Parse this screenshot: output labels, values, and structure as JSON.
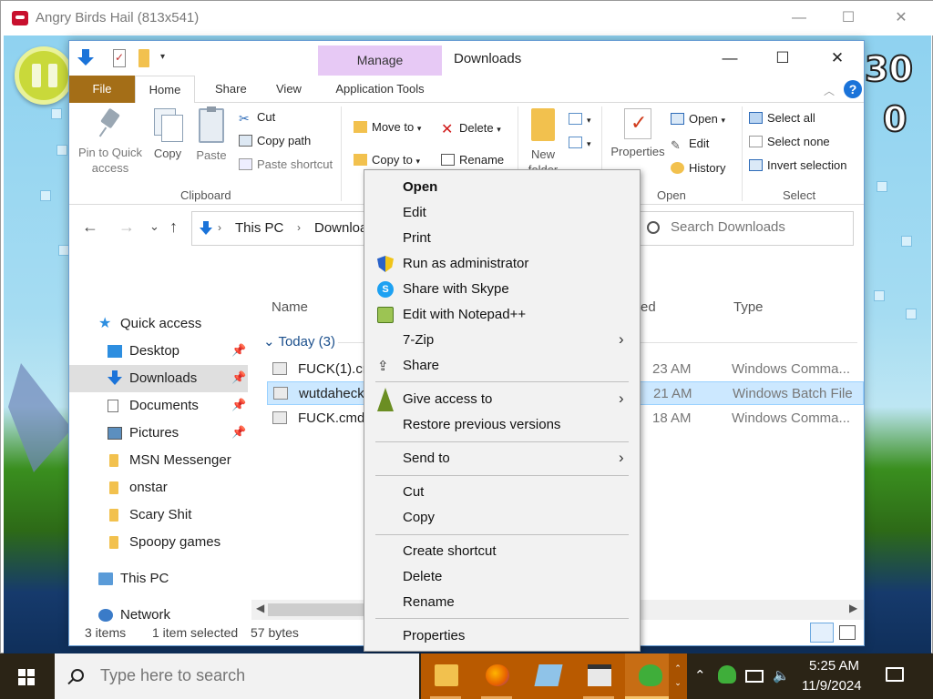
{
  "game_window": {
    "title": "Angry Birds Hail (813x541)",
    "controls": {
      "minimize": "—",
      "maximize": "☐",
      "close": "✕"
    },
    "scores": [
      "30",
      "0"
    ]
  },
  "explorer": {
    "title": "Downloads",
    "context_tab_header": "Manage",
    "controls": {
      "minimize": "—",
      "maximize": "☐",
      "close": "✕"
    },
    "tabs": {
      "file": "File",
      "home": "Home",
      "share": "Share",
      "view": "View",
      "app_tools": "Application Tools"
    },
    "ribbon": {
      "clipboard": {
        "group_label": "Clipboard",
        "pin": "Pin to Quick access",
        "copy": "Copy",
        "paste": "Paste",
        "cut": "Cut",
        "copy_path": "Copy path",
        "paste_shortcut": "Paste shortcut"
      },
      "organize": {
        "move_to": "Move to",
        "copy_to": "Copy to",
        "delete": "Delete",
        "rename": "Rename"
      },
      "new": {
        "new_folder": "New folder"
      },
      "open": {
        "group_label": "Open",
        "properties": "Properties",
        "open": "Open",
        "edit": "Edit",
        "history": "History"
      },
      "select": {
        "group_label": "Select",
        "select_all": "Select all",
        "select_none": "Select none",
        "invert": "Invert selection"
      }
    },
    "nav": {
      "back": "←",
      "forward": "→",
      "recent": "⌄",
      "up": "↑",
      "breadcrumb": [
        "This PC",
        "Downloads"
      ],
      "search_placeholder": "Search Downloads"
    },
    "sidebar": [
      {
        "label": "Quick access",
        "icon": "star-icon"
      },
      {
        "label": "Desktop",
        "icon": "desktop-icon",
        "pinned": true
      },
      {
        "label": "Downloads",
        "icon": "download-icon",
        "pinned": true,
        "selected": true
      },
      {
        "label": "Documents",
        "icon": "document-icon",
        "pinned": true
      },
      {
        "label": "Pictures",
        "icon": "pictures-icon",
        "pinned": true
      },
      {
        "label": "MSN Messenger",
        "icon": "folder-icon"
      },
      {
        "label": "onstar",
        "icon": "folder-icon"
      },
      {
        "label": "Scary Shit",
        "icon": "folder-icon"
      },
      {
        "label": "Spoopy games",
        "icon": "folder-icon"
      },
      {
        "label": "This PC",
        "icon": "computer-icon"
      },
      {
        "label": "Network",
        "icon": "network-icon"
      }
    ],
    "columns": {
      "name": "Name",
      "date": "ed",
      "type": "Type"
    },
    "group": "Today (3)",
    "files": [
      {
        "name": "FUCK(1).cmd",
        "date": "23 AM",
        "type": "Windows Comma..."
      },
      {
        "name": "wutdaheck.bat",
        "date": "21 AM",
        "type": "Windows Batch File",
        "selected": true
      },
      {
        "name": "FUCK.cmd",
        "date": "18 AM",
        "type": "Windows Comma..."
      }
    ],
    "status": {
      "count": "3 items",
      "selected": "1 item selected",
      "size": "57 bytes"
    }
  },
  "context_menu": [
    {
      "type": "item",
      "label": "Open",
      "bold": true
    },
    {
      "type": "item",
      "label": "Edit"
    },
    {
      "type": "item",
      "label": "Print"
    },
    {
      "type": "item",
      "label": "Run as administrator",
      "icon": "shield-icon"
    },
    {
      "type": "item",
      "label": "Share with Skype",
      "icon": "skype-icon"
    },
    {
      "type": "item",
      "label": "Edit with Notepad++",
      "icon": "notepad-plus-plus-icon"
    },
    {
      "type": "item",
      "label": "7-Zip",
      "submenu": true
    },
    {
      "type": "item",
      "label": "Share",
      "icon": "share-icon"
    },
    {
      "type": "sep"
    },
    {
      "type": "item",
      "label": "Give access to",
      "icon": "give-access-icon",
      "submenu": true
    },
    {
      "type": "item",
      "label": "Restore previous versions"
    },
    {
      "type": "sep"
    },
    {
      "type": "item",
      "label": "Send to",
      "submenu": true
    },
    {
      "type": "sep"
    },
    {
      "type": "item",
      "label": "Cut"
    },
    {
      "type": "item",
      "label": "Copy"
    },
    {
      "type": "sep"
    },
    {
      "type": "item",
      "label": "Create shortcut"
    },
    {
      "type": "item",
      "label": "Delete"
    },
    {
      "type": "item",
      "label": "Rename"
    },
    {
      "type": "sep"
    },
    {
      "type": "item",
      "label": "Properties"
    }
  ],
  "taskbar": {
    "search_placeholder": "Type here to search",
    "apps": [
      {
        "name": "file-explorer-icon",
        "color": "#f2c14e"
      },
      {
        "name": "firefox-icon",
        "color": "#e66000"
      },
      {
        "name": "notepad-icon",
        "color": "#8fc3e8"
      },
      {
        "name": "browser-window-icon",
        "color": "#e8e8e8"
      },
      {
        "name": "msn-messenger-icon",
        "color": "#3fae3a"
      }
    ],
    "clock_time": "5:25 AM",
    "clock_date": "11/9/2024"
  },
  "colors": {
    "file_tab": "#a46e17",
    "manage_tab": "#e7c9f5",
    "selection": "#cce8ff",
    "taskbar": "#2b2416",
    "taskbar_apps": "#b95a00"
  }
}
